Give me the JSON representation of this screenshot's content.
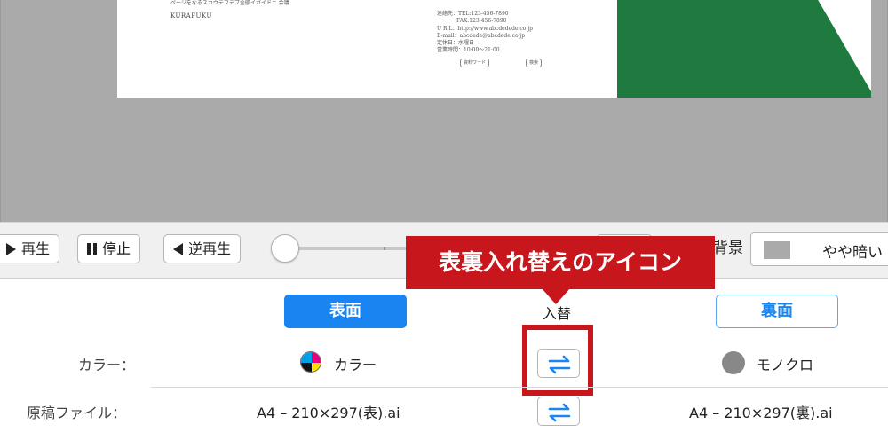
{
  "preview": {
    "card_lines": [
      "ページをなるスカウデフテプ全般イガイドニ 会議"
    ],
    "card_brand": "KURAFUKU",
    "card_info": [
      "連絡先：TEL:123-456-7890",
      "FAX:123-456-7890",
      "U R L：http://www.abcdedede.co.jp",
      "E-mail：abcdede@abcdede.co.jp",
      "定休日：水曜日",
      "営業時間：10:00〜21:00"
    ],
    "card_buttons": [
      "資料ワード",
      "検索"
    ],
    "card_green_color": "#1e7a3f"
  },
  "toolbar": {
    "play_label": "再生",
    "stop_label": "停止",
    "reverse_label": "逆再生",
    "background_label": "背景",
    "background_value": "やや暗い"
  },
  "callout": {
    "text": "表裏入れ替えのアイコン",
    "color": "#c8161d"
  },
  "panel": {
    "front_label": "表面",
    "back_label": "裏面",
    "swap_label": "入替",
    "color_row_label": "カラー：",
    "file_row_label": "原稿ファイル：",
    "front_color_value": "カラー",
    "back_color_value": "モノクロ",
    "front_file": "A4 – 210×297(表).ai",
    "back_file": "A4 – 210×297(裏).ai",
    "accent_color": "#1a84f0",
    "icons": [
      "play-icon",
      "pause-icon",
      "reverse-play-icon",
      "cmyk-color-icon",
      "mono-color-icon",
      "swap-arrows-icon"
    ]
  }
}
